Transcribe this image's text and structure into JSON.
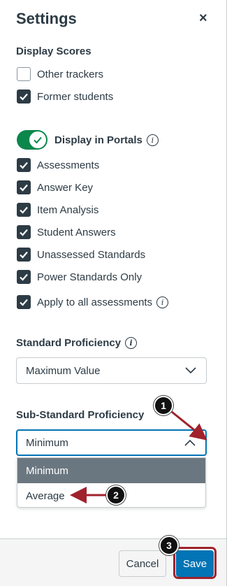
{
  "panel": {
    "title": "Settings",
    "close_symbol": "×"
  },
  "display_scores": {
    "label": "Display Scores",
    "options": [
      {
        "label": "Other trackers",
        "checked": false
      },
      {
        "label": "Former students",
        "checked": true
      }
    ]
  },
  "portals": {
    "toggle_label": "Display in Portals",
    "toggle_on": true,
    "info_symbol": "i",
    "options": [
      {
        "label": "Assessments",
        "checked": true
      },
      {
        "label": "Answer Key",
        "checked": true
      },
      {
        "label": "Item Analysis",
        "checked": true
      },
      {
        "label": "Student Answers",
        "checked": true
      },
      {
        "label": "Unassessed Standards",
        "checked": true
      },
      {
        "label": "Power Standards Only",
        "checked": true
      },
      {
        "label": "Apply to all assessments",
        "checked": true
      }
    ]
  },
  "standard_proficiency": {
    "label": "Standard Proficiency",
    "value": "Maximum Value"
  },
  "sub_standard_proficiency": {
    "label": "Sub-Standard Proficiency",
    "value": "Minimum",
    "dropdown_options": [
      "Minimum",
      "Average"
    ]
  },
  "footer": {
    "cancel_label": "Cancel",
    "save_label": "Save"
  },
  "callouts": [
    "1",
    "2",
    "3"
  ],
  "colors": {
    "text": "#2d3b45",
    "toggle_green": "#0b874b",
    "save_blue": "#0374b5",
    "highlight_red": "#a0222c",
    "selected_option": "#6b7780"
  }
}
